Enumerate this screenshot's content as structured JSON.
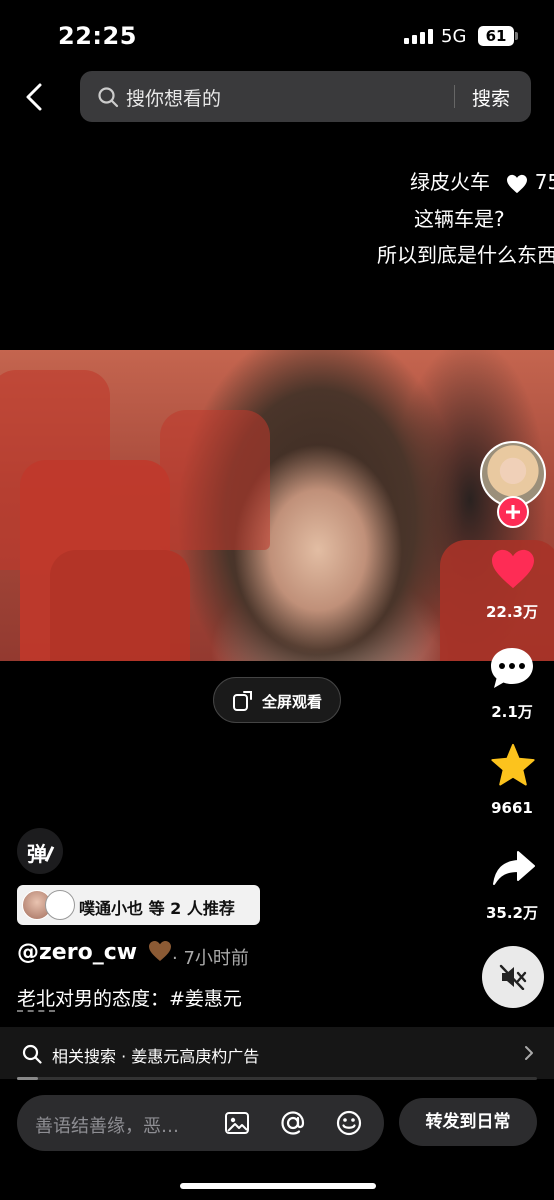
{
  "status_bar": {
    "time": "22:25",
    "network": "5G",
    "battery": "61"
  },
  "header": {
    "search_placeholder": "搜你想看的",
    "search_button": "搜索"
  },
  "danmaku": [
    {
      "text": "绿皮火车",
      "likes": "75"
    },
    {
      "text": "这辆车是?"
    },
    {
      "text": "所以到底是什么东西"
    }
  ],
  "video": {
    "fullscreen_label": "全屏观看"
  },
  "actions": {
    "likes": "22.3万",
    "comments": "2.1万",
    "favorites": "9661",
    "shares": "35.2万"
  },
  "post": {
    "danmaku_toggle": "弹",
    "recommend_text": "噗通小也 等 2 人推荐",
    "author": "@zero_cw",
    "time_ago": "· 7小时前",
    "caption_prefix": "老北",
    "caption_rest": "对男的态度：#姜惠元"
  },
  "related": {
    "text": "相关搜索 · 姜惠元高庚杓广告",
    "progress": 0.04
  },
  "comment_bar": {
    "placeholder": "善语结善缘，恶…",
    "share_button": "转发到日常"
  },
  "colors": {
    "like": "#fe2c55",
    "favorite": "#fcc31d",
    "background": "#000000"
  },
  "icons": [
    "back-icon",
    "search-icon",
    "heart-icon",
    "comment-icon",
    "star-icon",
    "share-icon",
    "mute-icon",
    "image-icon",
    "at-icon",
    "emoji-icon",
    "chevron-right-icon"
  ]
}
